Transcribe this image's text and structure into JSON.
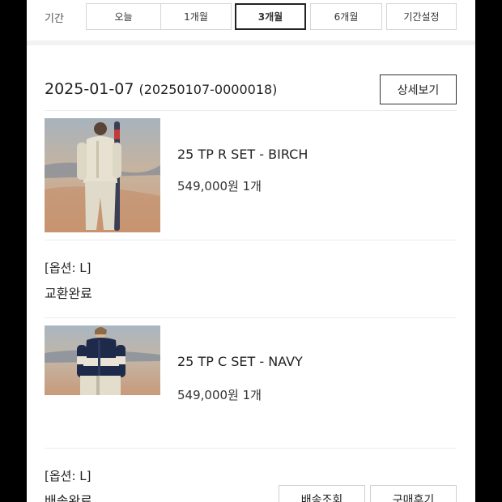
{
  "period": {
    "label": "기간",
    "options": [
      "오늘",
      "1개월",
      "3개월",
      "6개월",
      "기간설정"
    ],
    "selected": "3개월"
  },
  "order": {
    "date": "2025-01-07",
    "number": "(20250107-0000018)",
    "detail_button": "상세보기"
  },
  "items": [
    {
      "name": "25 TP R SET - BIRCH",
      "price": "549,000원",
      "qty": "1개",
      "option": "[옵션: L]",
      "status": "교환완료"
    },
    {
      "name": "25 TP C SET - NAVY",
      "price": "549,000원",
      "qty": "1개",
      "option": "[옵션: L]",
      "status": "배송완료",
      "actions": [
        "배송조회",
        "구매후기"
      ]
    }
  ]
}
